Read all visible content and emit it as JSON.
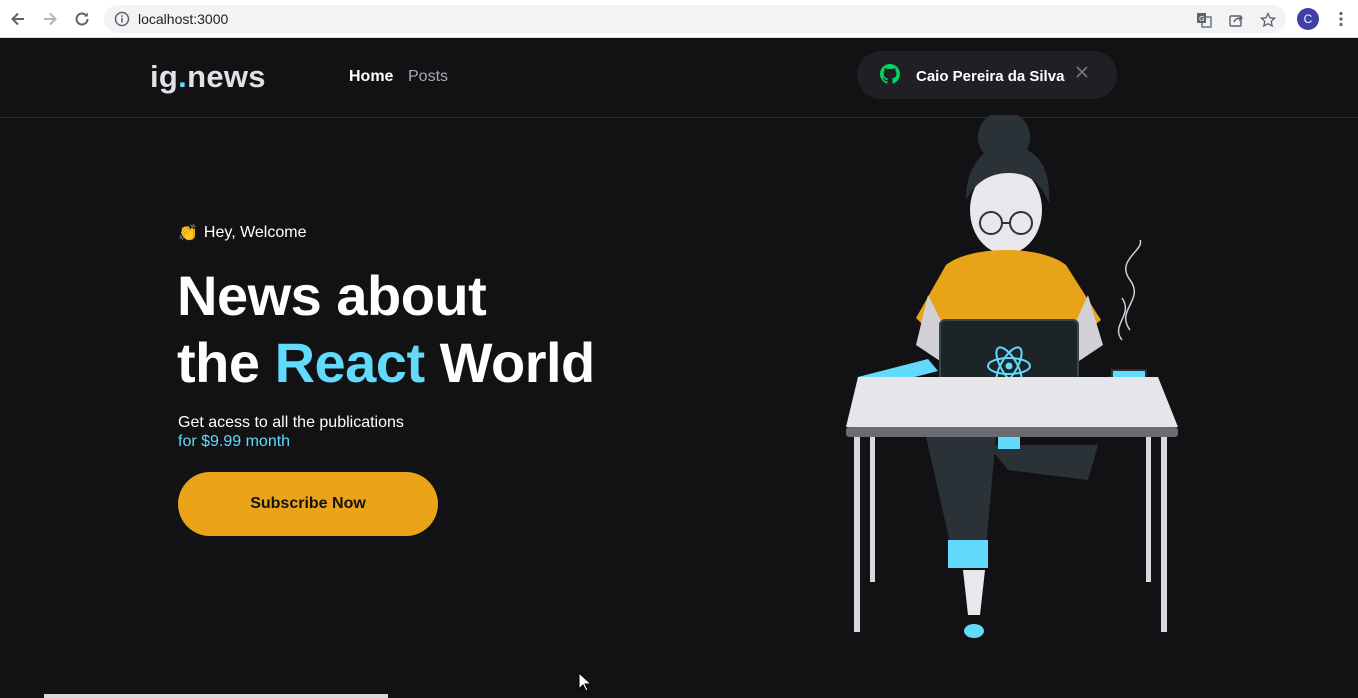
{
  "browser": {
    "url": "localhost:3000",
    "profile_initial": "C"
  },
  "header": {
    "logo_main": "ig",
    "logo_dot": ".",
    "logo_rest": "news",
    "nav": [
      "Home",
      "Posts"
    ],
    "active_nav": "Home",
    "user_name": "Caio Pereira da Silva"
  },
  "hero": {
    "welcome_emoji": "👏",
    "welcome_text": "Hey, Welcome",
    "headline_line1": "News about",
    "headline_the": "the",
    "headline_accent": "React",
    "headline_world": "World",
    "sub_line1": "Get acess to all the publications",
    "sub_line2": "for $9.99 month",
    "subscribe_label": "Subscribe Now"
  },
  "colors": {
    "background": "#121214",
    "accent_cyan": "#61dafb",
    "button_yellow": "#eba417",
    "pill_bg": "#202024"
  }
}
